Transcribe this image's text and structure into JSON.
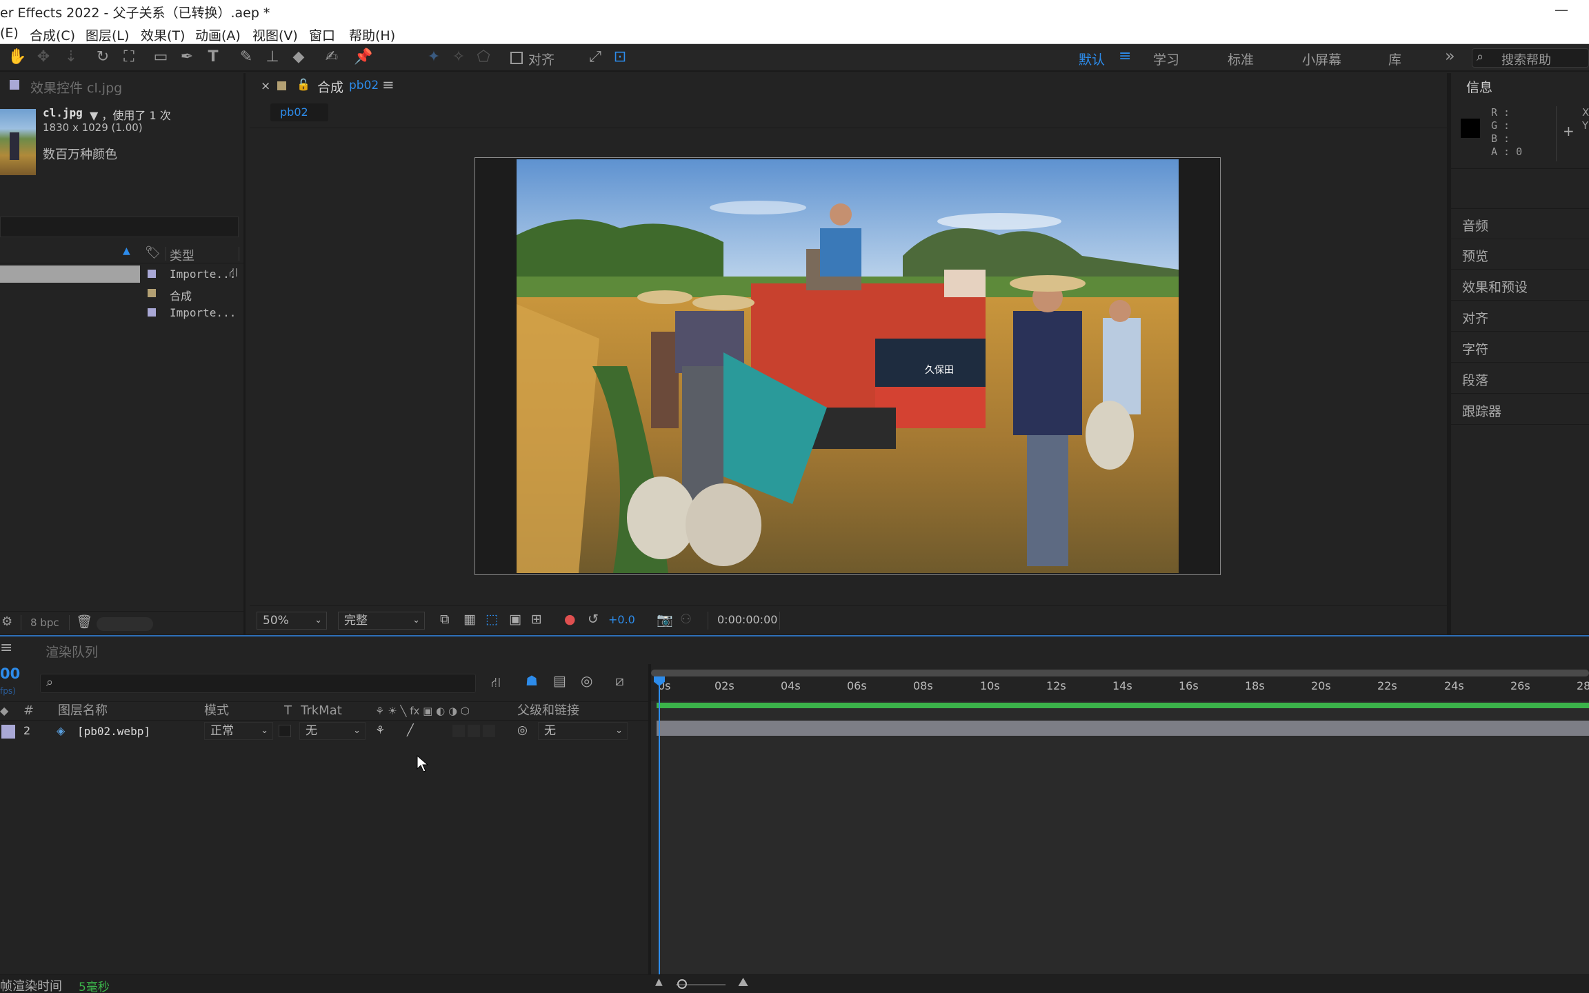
{
  "title_bar": {
    "title": "er Effects 2022 - 父子关系（已转换）.aep *",
    "minimize_glyph": "—"
  },
  "menu": [
    "(E)",
    "合成(C)",
    "图层(L)",
    "效果(T)",
    "动画(A)",
    "视图(V)",
    "窗口",
    "帮助(H)"
  ],
  "toolbar": {
    "align_label": "对齐",
    "workspaces": [
      "默认",
      "学习",
      "标准",
      "小屏幕",
      "库"
    ],
    "active_workspace": "默认",
    "more_glyph": "»",
    "search_placeholder": "搜索帮助"
  },
  "project_panel": {
    "tab_label": "效果控件 cl.jpg",
    "file_name": "cl.jpg",
    "usage_text": "▼ ，使用了 1 次",
    "dimensions": "1830 x 1029 (1.00)",
    "color_text": "数百万种颜色",
    "type_header": "类型",
    "items": [
      {
        "type": "Importe...",
        "color": "#a9a8d6"
      },
      {
        "type": "合成",
        "color": "#b3a073"
      },
      {
        "type": "Importe...",
        "color": "#a9a8d6"
      }
    ],
    "bpc": "8 bpc"
  },
  "composition_panel": {
    "close_glyph": "×",
    "tab_prefix": "合成",
    "comp_name": "pb02",
    "menu_glyph": "≡",
    "breadcrumb": "pb02",
    "zoom": "50%",
    "resolution": "完整",
    "exposure": "+0.0",
    "timecode": "0:00:00:00",
    "frame_text": "久保田"
  },
  "right_panel": {
    "info_title": "信息",
    "rgba": [
      "R :",
      "G :",
      "B :",
      "A : 0"
    ],
    "xy": [
      "X",
      "Y"
    ],
    "items": [
      "音频",
      "预览",
      "效果和预设",
      "对齐",
      "字符",
      "段落",
      "跟踪器"
    ]
  },
  "timeline": {
    "tab_label": "渲染队列",
    "time_partial": "00",
    "fps_partial": "fps)",
    "columns": {
      "num": "#",
      "name": "图层名称",
      "mode": "模式",
      "t": "T",
      "trkmat": "TrkMat",
      "parent": "父级和链接"
    },
    "layer": {
      "index": "2",
      "name": "[pb02.webp]",
      "mode": "正常",
      "trkmat": "无",
      "parent": "无"
    },
    "ruler": [
      "0s",
      "02s",
      "04s",
      "06s",
      "08s",
      "10s",
      "12s",
      "14s",
      "16s",
      "18s",
      "20s",
      "22s",
      "24s",
      "26s",
      "28"
    ],
    "status_label": "帧渲染时间",
    "status_value": "5毫秒"
  },
  "colors": {
    "accent": "#2d8ceb",
    "panel": "#232323",
    "darker": "#1a1a1a",
    "track_green": "#3bb34a",
    "label_lavender": "#a9a8d6"
  }
}
